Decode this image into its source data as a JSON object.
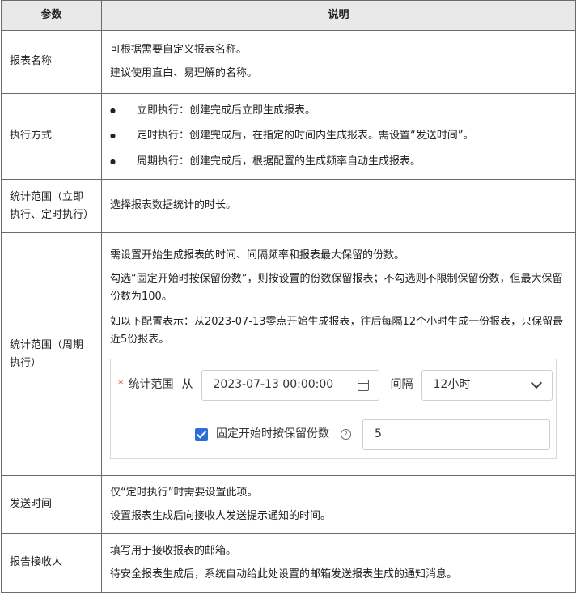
{
  "headers": {
    "param": "参数",
    "desc": "说明"
  },
  "rows": [
    {
      "param": "报表名称",
      "lines": [
        "可根据需要自定义报表名称。",
        "建议使用直白、易理解的名称。"
      ]
    },
    {
      "param": "执行方式",
      "bullets": [
        "立即执行：创建完成后立即生成报表。",
        "定时执行：创建完成后，在指定的时间内生成报表。需设置“发送时间”。",
        "周期执行：创建完成后，根据配置的生成频率自动生成报表。"
      ]
    },
    {
      "param": "统计范围（立即执行、定时执行）",
      "lines": [
        "选择报表数据统计的时长。"
      ]
    },
    {
      "param": "统计范围（周期执行）",
      "lines": [
        "需设置开始生成报表的时间、间隔频率和报表最大保留的份数。",
        "勾选“固定开始时按保留份数”，则按设置的份数保留报表；不勾选则不限制保留份数，但最大保留份数为100。",
        "如以下配置表示：从2023-07-13零点开始生成报表，往后每隔12个小时生成一份报表，只保留最近5份报表。"
      ]
    },
    {
      "param": "发送时间",
      "lines": [
        "仅“定时执行”时需要设置此项。",
        "设置报表生成后向接收人发送提示通知的时间。"
      ]
    },
    {
      "param": "报告接收人",
      "lines": [
        "填写用于接收报表的邮箱。",
        "待安全报表生成后，系统自动给此处设置的邮箱发送报表生成的通知消息。"
      ]
    }
  ],
  "form": {
    "required_mark": "*",
    "range_label": "统计范围",
    "from_label": "从",
    "datetime_value": "2023-07-13 00:00:00",
    "interval_label": "间隔",
    "interval_value": "12小时",
    "checkbox_label": "固定开始时按保留份数",
    "checkbox_checked": true,
    "help_glyph": "?",
    "count_value": "5",
    "checkbox_color": "#2d6ed6"
  }
}
